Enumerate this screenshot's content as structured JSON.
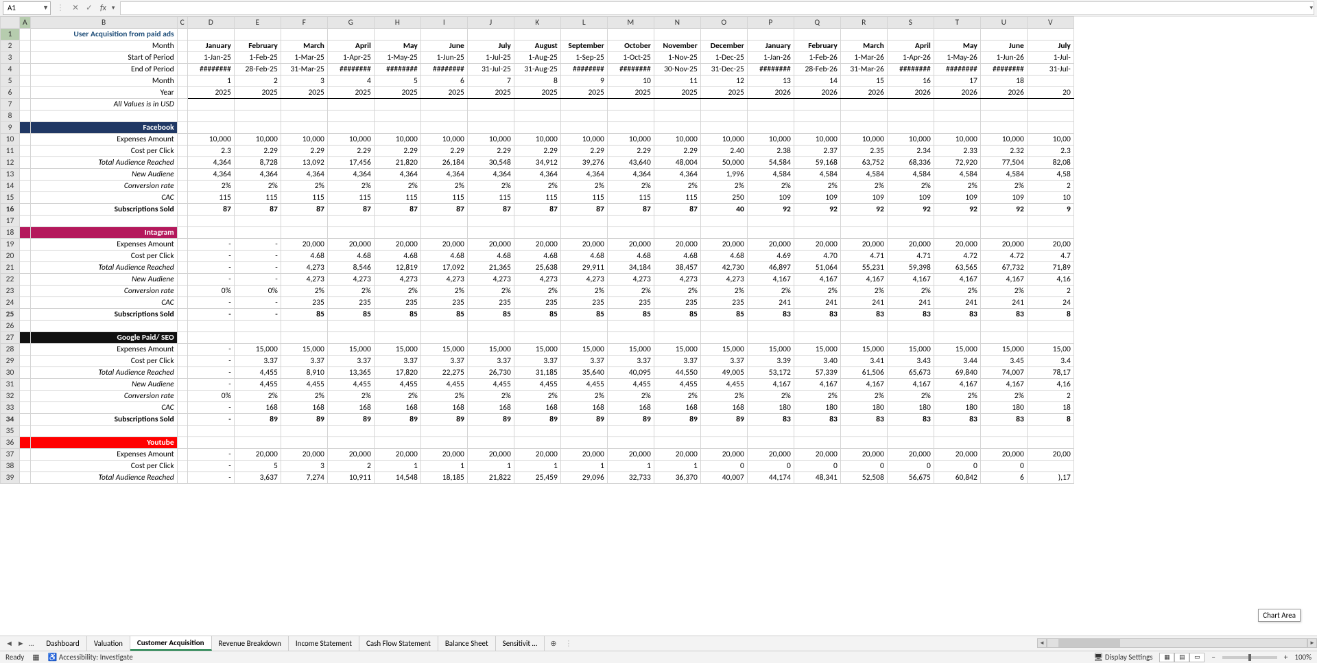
{
  "cell_ref": "A1",
  "fx": "fx",
  "chart_tip": "Chart Area",
  "tabs": [
    "Dashboard",
    "Valuation",
    "Customer Acquisition",
    "Revenue Breakdown",
    "Income Statement",
    "Cash Flow Statement",
    "Balance Sheet",
    "Sensitivit …"
  ],
  "active_tab": "Customer Acquisition",
  "nav_ellipsis": "…",
  "status": {
    "ready": "Ready",
    "accessibility": "Accessibility: Investigate",
    "display": "Display Settings",
    "zoom": "100%"
  },
  "cols": [
    "",
    "A",
    "B",
    "C",
    "D",
    "E",
    "F",
    "G",
    "H",
    "I",
    "J",
    "K",
    "L",
    "M",
    "N",
    "O",
    "P",
    "Q",
    "R",
    "S",
    "T",
    "U",
    "V"
  ],
  "title": "User Acquisition from paid ads",
  "labels": {
    "month": "Month",
    "start": "Start of Period",
    "end": "End of Period",
    "month2": "Month",
    "year": "Year",
    "usd": "All Values is in USD",
    "fb": "Facebook",
    "ig": "Intagram",
    "gg": "Google Paid/ SEO",
    "yt": "Youtube",
    "exp": "Expenses Amount",
    "cpc": "Cost per Click",
    "tar": "Total Audience Reached",
    "new": "New Audiene",
    "conv": "Conversion rate",
    "cac": "CAC",
    "subs": "Subscriptions Sold"
  },
  "months": [
    "January",
    "February",
    "March",
    "April",
    "May",
    "June",
    "July",
    "August",
    "September",
    "October",
    "November",
    "December",
    "January",
    "February",
    "March",
    "April",
    "May",
    "June",
    "July"
  ],
  "start": [
    "1-Jan-25",
    "1-Feb-25",
    "1-Mar-25",
    "1-Apr-25",
    "1-May-25",
    "1-Jun-25",
    "1-Jul-25",
    "1-Aug-25",
    "1-Sep-25",
    "1-Oct-25",
    "1-Nov-25",
    "1-Dec-25",
    "1-Jan-26",
    "1-Feb-26",
    "1-Mar-26",
    "1-Apr-26",
    "1-May-26",
    "1-Jun-26",
    "1-Jul-"
  ],
  "end": [
    "########",
    "28-Feb-25",
    "31-Mar-25",
    "########",
    "########",
    "########",
    "31-Jul-25",
    "31-Aug-25",
    "########",
    "########",
    "30-Nov-25",
    "31-Dec-25",
    "########",
    "28-Feb-26",
    "31-Mar-26",
    "########",
    "########",
    "########",
    "31-Jul-"
  ],
  "mnum": [
    "1",
    "2",
    "3",
    "4",
    "5",
    "6",
    "7",
    "8",
    "9",
    "10",
    "11",
    "12",
    "13",
    "14",
    "15",
    "16",
    "17",
    "18",
    ""
  ],
  "year": [
    "2025",
    "2025",
    "2025",
    "2025",
    "2025",
    "2025",
    "2025",
    "2025",
    "2025",
    "2025",
    "2025",
    "2025",
    "2026",
    "2026",
    "2026",
    "2026",
    "2026",
    "2026",
    "20"
  ],
  "fb": {
    "exp": [
      "10,000",
      "10,000",
      "10,000",
      "10,000",
      "10,000",
      "10,000",
      "10,000",
      "10,000",
      "10,000",
      "10,000",
      "10,000",
      "10,000",
      "10,000",
      "10,000",
      "10,000",
      "10,000",
      "10,000",
      "10,000",
      "10,00"
    ],
    "cpc": [
      "2.3",
      "2.29",
      "2.29",
      "2.29",
      "2.29",
      "2.29",
      "2.29",
      "2.29",
      "2.29",
      "2.29",
      "2.29",
      "2.40",
      "2.38",
      "2.37",
      "2.35",
      "2.34",
      "2.33",
      "2.32",
      "2.3"
    ],
    "tar": [
      "4,364",
      "8,728",
      "13,092",
      "17,456",
      "21,820",
      "26,184",
      "30,548",
      "34,912",
      "39,276",
      "43,640",
      "48,004",
      "50,000",
      "54,584",
      "59,168",
      "63,752",
      "68,336",
      "72,920",
      "77,504",
      "82,08"
    ],
    "new": [
      "4,364",
      "4,364",
      "4,364",
      "4,364",
      "4,364",
      "4,364",
      "4,364",
      "4,364",
      "4,364",
      "4,364",
      "4,364",
      "1,996",
      "4,584",
      "4,584",
      "4,584",
      "4,584",
      "4,584",
      "4,584",
      "4,58"
    ],
    "conv": [
      "2%",
      "2%",
      "2%",
      "2%",
      "2%",
      "2%",
      "2%",
      "2%",
      "2%",
      "2%",
      "2%",
      "2%",
      "2%",
      "2%",
      "2%",
      "2%",
      "2%",
      "2%",
      "2"
    ],
    "cac": [
      "115",
      "115",
      "115",
      "115",
      "115",
      "115",
      "115",
      "115",
      "115",
      "115",
      "115",
      "250",
      "109",
      "109",
      "109",
      "109",
      "109",
      "109",
      "10"
    ],
    "subs": [
      "87",
      "87",
      "87",
      "87",
      "87",
      "87",
      "87",
      "87",
      "87",
      "87",
      "87",
      "40",
      "92",
      "92",
      "92",
      "92",
      "92",
      "92",
      "9"
    ]
  },
  "ig": {
    "exp": [
      "-",
      "-",
      "20,000",
      "20,000",
      "20,000",
      "20,000",
      "20,000",
      "20,000",
      "20,000",
      "20,000",
      "20,000",
      "20,000",
      "20,000",
      "20,000",
      "20,000",
      "20,000",
      "20,000",
      "20,000",
      "20,00"
    ],
    "cpc": [
      "-",
      "-",
      "4.68",
      "4.68",
      "4.68",
      "4.68",
      "4.68",
      "4.68",
      "4.68",
      "4.68",
      "4.68",
      "4.68",
      "4.69",
      "4.70",
      "4.71",
      "4.71",
      "4.72",
      "4.72",
      "4.7"
    ],
    "tar": [
      "-",
      "-",
      "4,273",
      "8,546",
      "12,819",
      "17,092",
      "21,365",
      "25,638",
      "29,911",
      "34,184",
      "38,457",
      "42,730",
      "46,897",
      "51,064",
      "55,231",
      "59,398",
      "63,565",
      "67,732",
      "71,89"
    ],
    "new": [
      "-",
      "-",
      "4,273",
      "4,273",
      "4,273",
      "4,273",
      "4,273",
      "4,273",
      "4,273",
      "4,273",
      "4,273",
      "4,273",
      "4,167",
      "4,167",
      "4,167",
      "4,167",
      "4,167",
      "4,167",
      "4,16"
    ],
    "conv": [
      "0%",
      "0%",
      "2%",
      "2%",
      "2%",
      "2%",
      "2%",
      "2%",
      "2%",
      "2%",
      "2%",
      "2%",
      "2%",
      "2%",
      "2%",
      "2%",
      "2%",
      "2%",
      "2"
    ],
    "cac": [
      "-",
      "-",
      "235",
      "235",
      "235",
      "235",
      "235",
      "235",
      "235",
      "235",
      "235",
      "235",
      "241",
      "241",
      "241",
      "241",
      "241",
      "241",
      "24"
    ],
    "subs": [
      "-",
      "-",
      "85",
      "85",
      "85",
      "85",
      "85",
      "85",
      "85",
      "85",
      "85",
      "85",
      "83",
      "83",
      "83",
      "83",
      "83",
      "83",
      "8"
    ]
  },
  "gg": {
    "exp": [
      "-",
      "15,000",
      "15,000",
      "15,000",
      "15,000",
      "15,000",
      "15,000",
      "15,000",
      "15,000",
      "15,000",
      "15,000",
      "15,000",
      "15,000",
      "15,000",
      "15,000",
      "15,000",
      "15,000",
      "15,000",
      "15,00"
    ],
    "cpc": [
      "-",
      "3.37",
      "3.37",
      "3.37",
      "3.37",
      "3.37",
      "3.37",
      "3.37",
      "3.37",
      "3.37",
      "3.37",
      "3.37",
      "3.39",
      "3.40",
      "3.41",
      "3.43",
      "3.44",
      "3.45",
      "3.4"
    ],
    "tar": [
      "-",
      "4,455",
      "8,910",
      "13,365",
      "17,820",
      "22,275",
      "26,730",
      "31,185",
      "35,640",
      "40,095",
      "44,550",
      "49,005",
      "53,172",
      "57,339",
      "61,506",
      "65,673",
      "69,840",
      "74,007",
      "78,17"
    ],
    "new": [
      "-",
      "4,455",
      "4,455",
      "4,455",
      "4,455",
      "4,455",
      "4,455",
      "4,455",
      "4,455",
      "4,455",
      "4,455",
      "4,455",
      "4,167",
      "4,167",
      "4,167",
      "4,167",
      "4,167",
      "4,167",
      "4,16"
    ],
    "conv": [
      "0%",
      "2%",
      "2%",
      "2%",
      "2%",
      "2%",
      "2%",
      "2%",
      "2%",
      "2%",
      "2%",
      "2%",
      "2%",
      "2%",
      "2%",
      "2%",
      "2%",
      "2%",
      "2"
    ],
    "cac": [
      "-",
      "168",
      "168",
      "168",
      "168",
      "168",
      "168",
      "168",
      "168",
      "168",
      "168",
      "168",
      "180",
      "180",
      "180",
      "180",
      "180",
      "180",
      "18"
    ],
    "subs": [
      "-",
      "89",
      "89",
      "89",
      "89",
      "89",
      "89",
      "89",
      "89",
      "89",
      "89",
      "89",
      "83",
      "83",
      "83",
      "83",
      "83",
      "83",
      "8"
    ]
  },
  "yt": {
    "exp": [
      "-",
      "20,000",
      "20,000",
      "20,000",
      "20,000",
      "20,000",
      "20,000",
      "20,000",
      "20,000",
      "20,000",
      "20,000",
      "20,000",
      "20,000",
      "20,000",
      "20,000",
      "20,000",
      "20,000",
      "20,000",
      "20,00"
    ],
    "cpc": [
      "-",
      "5",
      "3",
      "2",
      "1",
      "1",
      "1",
      "1",
      "1",
      "1",
      "1",
      "0",
      "0",
      "0",
      "0",
      "0",
      "0",
      "0",
      ""
    ],
    "tar": [
      "-",
      "3,637",
      "7,274",
      "10,911",
      "14,548",
      "18,185",
      "21,822",
      "25,459",
      "29,096",
      "32,733",
      "36,370",
      "40,007",
      "44,174",
      "48,341",
      "52,508",
      "56,675",
      "60,842",
      "6",
      "),17"
    ]
  }
}
